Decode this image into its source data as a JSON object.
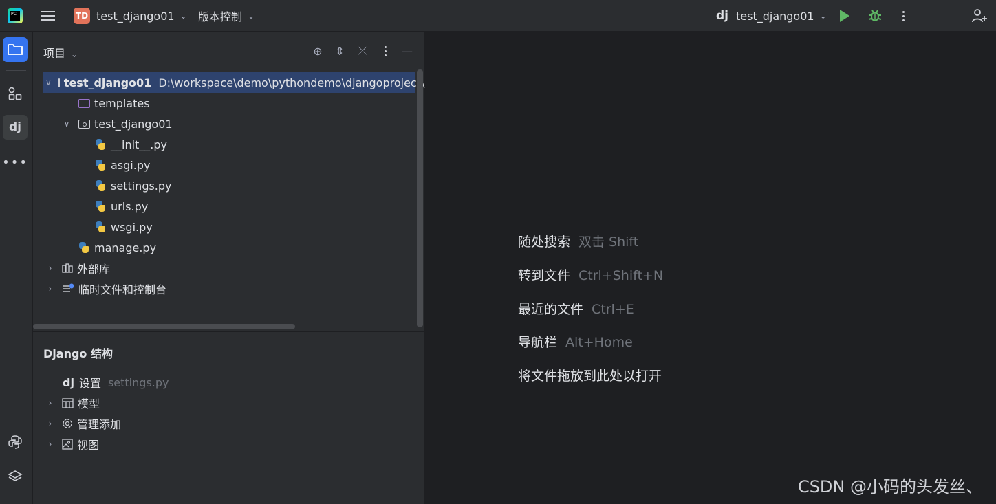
{
  "titlebar": {
    "project_badge": "TD",
    "project_name": "test_django01",
    "vcs_menu": "版本控制",
    "run_config_icon": "dj",
    "run_config": "test_django01"
  },
  "panel": {
    "title": "项目",
    "tree": {
      "root_name": "test_django01",
      "root_path": "D:\\workspace\\demo\\pythondemo\\djangoproject\\",
      "templates": "templates",
      "package": "test_django01",
      "files": [
        "__init__.py",
        "asgi.py",
        "settings.py",
        "urls.py",
        "wsgi.py"
      ],
      "manage": "manage.py",
      "external_libs": "外部库",
      "scratches": "临时文件和控制台"
    }
  },
  "django": {
    "title": "Django 结构",
    "settings_icon": "dj",
    "settings_label": "设置",
    "settings_file": "settings.py",
    "models": "模型",
    "admin": "管理添加",
    "views": "视图"
  },
  "editor": {
    "hints": [
      {
        "label": "随处搜索",
        "key": "双击 Shift"
      },
      {
        "label": "转到文件",
        "key": "Ctrl+Shift+N"
      },
      {
        "label": "最近的文件",
        "key": "Ctrl+E"
      },
      {
        "label": "导航栏",
        "key": "Alt+Home"
      },
      {
        "label": "将文件拖放到此处以打开",
        "key": ""
      }
    ]
  },
  "watermark": "CSDN @小码的头发丝、",
  "colors": {
    "accent": "#3574f0",
    "selection": "#2e436e",
    "run": "#5fb865",
    "badge": "#e2735a"
  }
}
